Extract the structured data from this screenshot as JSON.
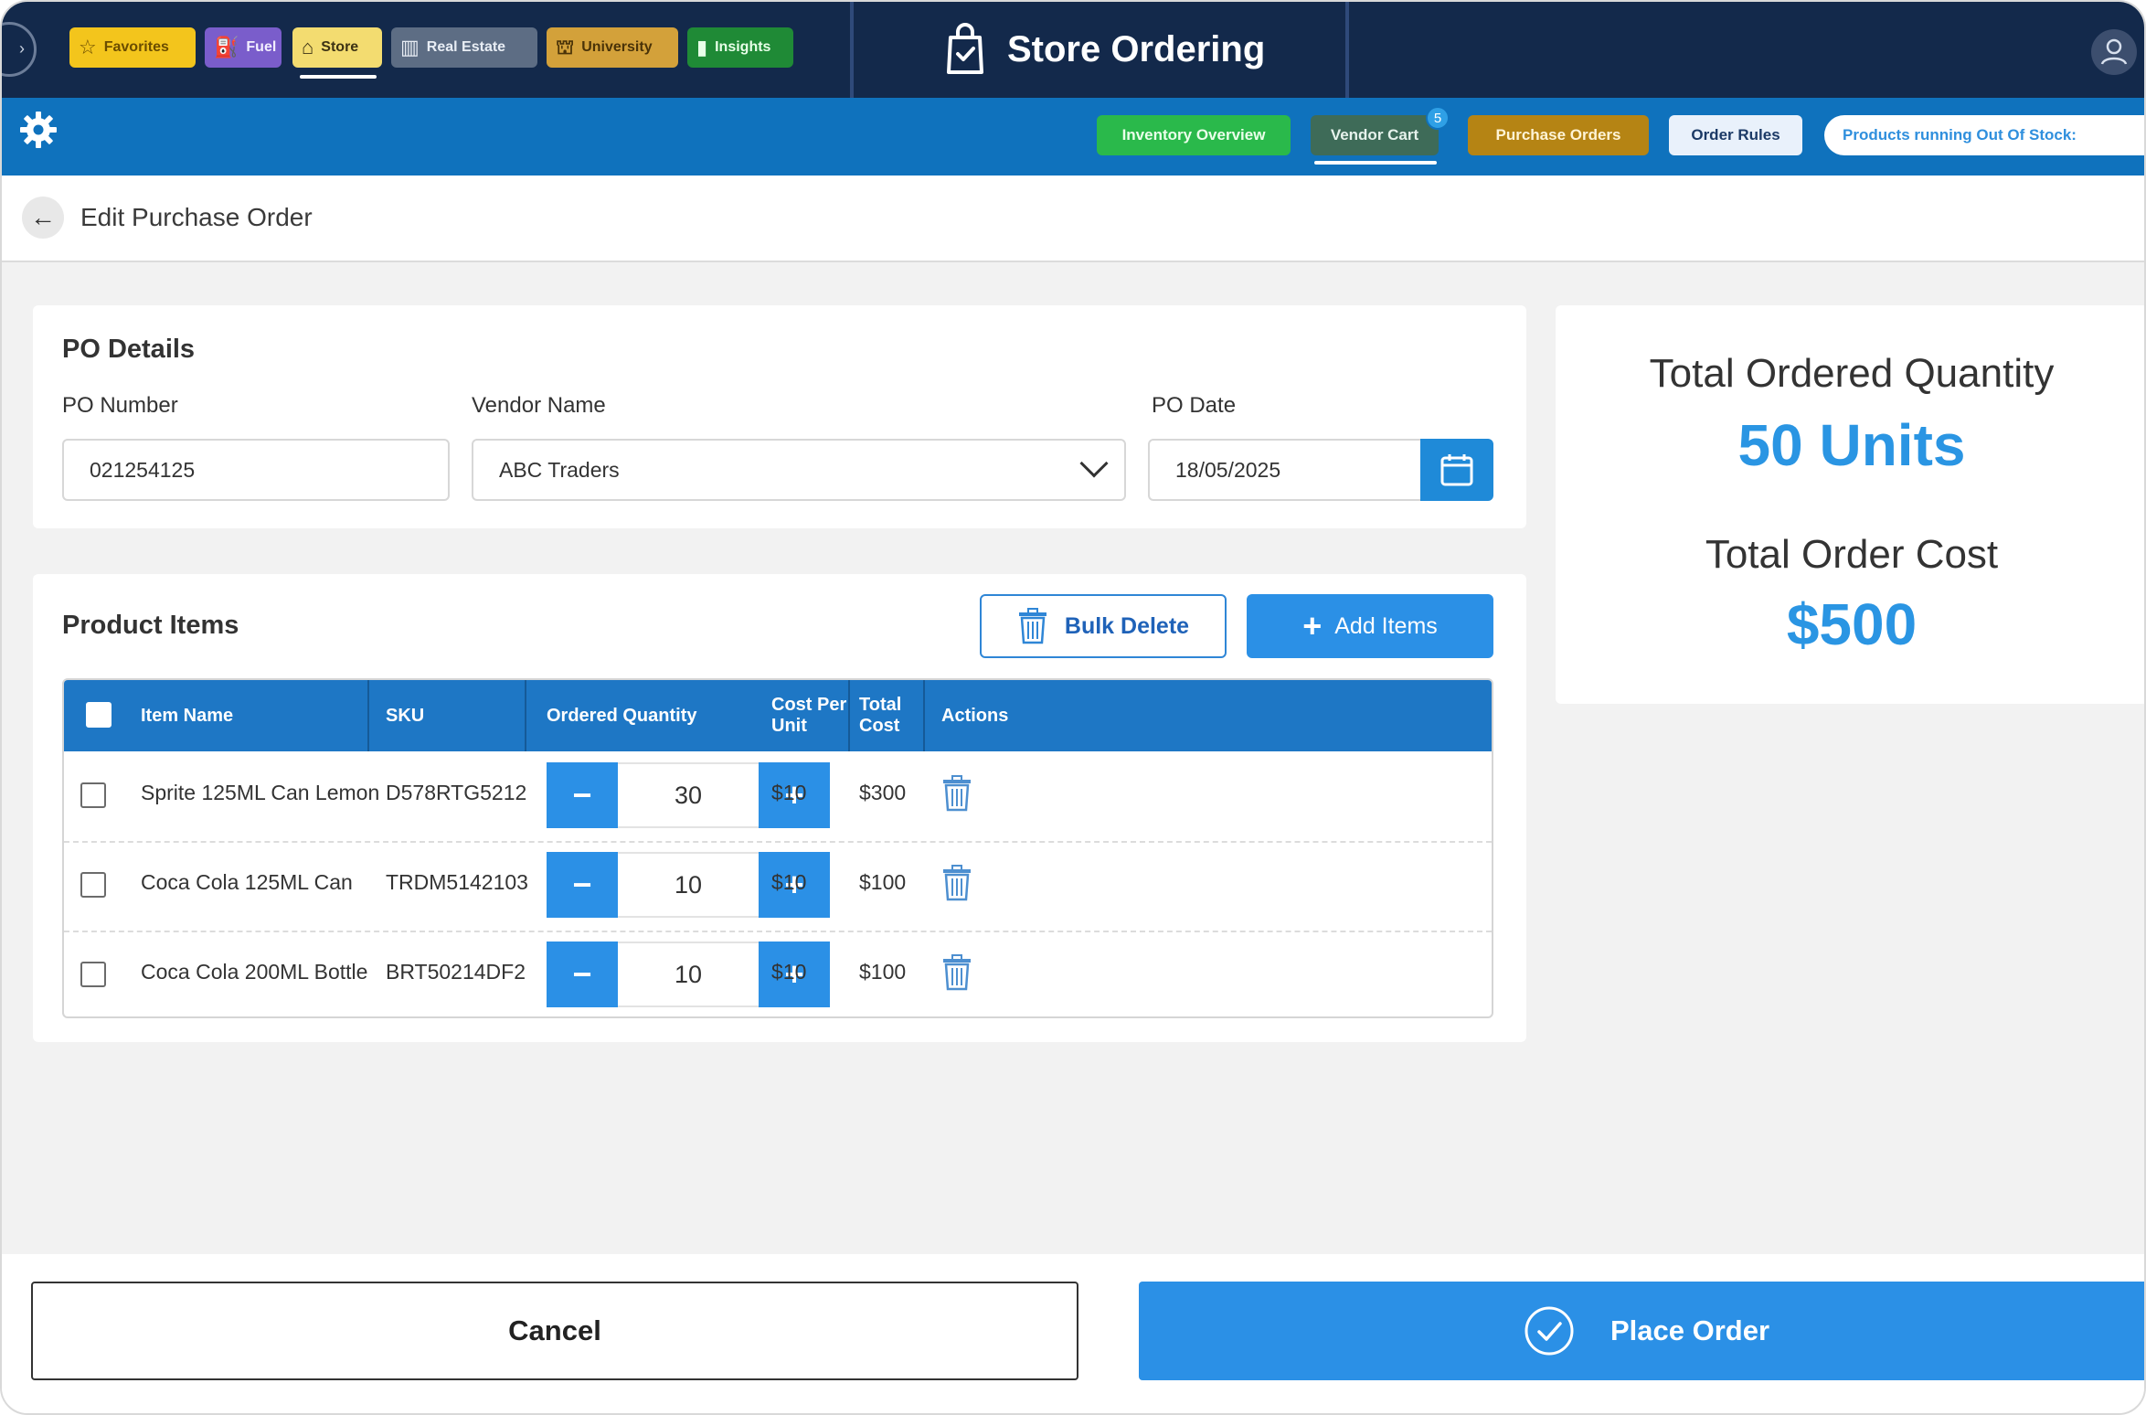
{
  "app": {
    "title": "Store Ordering",
    "tabs": [
      {
        "label": "Favorites",
        "icon": "star-icon"
      },
      {
        "label": "Fuel",
        "icon": "fuel-icon"
      },
      {
        "label": "Store",
        "icon": "store-icon"
      },
      {
        "label": "Real Estate",
        "icon": "building-icon"
      },
      {
        "label": "University",
        "icon": "graduation-icon"
      },
      {
        "label": "Insights",
        "icon": "bar-chart-icon"
      }
    ]
  },
  "subnav": {
    "items": [
      {
        "label": "Inventory Overview"
      },
      {
        "label": "Vendor Cart",
        "badge": "5"
      },
      {
        "label": "Purchase Orders"
      },
      {
        "label": "Order Rules"
      },
      {
        "label": "Products running Out Of Stock:"
      }
    ]
  },
  "page": {
    "title": "Edit Purchase Order"
  },
  "po_details": {
    "section_title": "PO Details",
    "po_number_label": "PO Number",
    "po_number_value": "021254125",
    "vendor_label": "Vendor Name",
    "vendor_value": "ABC Traders",
    "date_label": "PO Date",
    "date_value": "18/05/2025"
  },
  "product_items": {
    "section_title": "Product Items",
    "bulk_delete_label": "Bulk Delete",
    "add_items_label": "Add Items",
    "columns": [
      "Item Name",
      "SKU",
      "Ordered Quantity",
      "Cost Per Unit",
      "Total Cost",
      "Actions"
    ],
    "rows": [
      {
        "name": "Sprite 125ML Can Lemon",
        "sku": "D578RTG5212",
        "qty": "30",
        "cost": "$10",
        "total": "$300"
      },
      {
        "name": "Coca Cola 125ML Can",
        "sku": "TRDM5142103",
        "qty": "10",
        "cost": "$10",
        "total": "$100"
      },
      {
        "name": "Coca Cola 200ML Bottle",
        "sku": "BRT50214DF2",
        "qty": "10",
        "cost": "$10",
        "total": "$100"
      }
    ],
    "minus_label": "−",
    "plus_label": "+"
  },
  "summary": {
    "qty_label": "Total Ordered Quantity",
    "qty_value": "50 Units",
    "cost_label": "Total Order Cost",
    "cost_value": "$500"
  },
  "footer": {
    "cancel_label": "Cancel",
    "place_label": "Place Order"
  },
  "colors": {
    "topbar": "#13294b",
    "subbar": "#0f72bd",
    "accent": "#2b90e6",
    "table_header": "#1e77c5"
  }
}
